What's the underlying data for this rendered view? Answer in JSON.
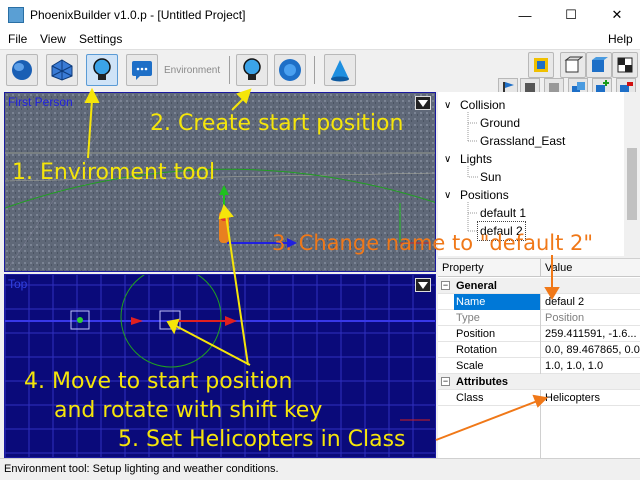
{
  "window": {
    "title": "PhoenixBuilder v1.0.p  - [Untitled Project]",
    "minimize": "—",
    "maximize": "☐",
    "close": "✕"
  },
  "menu": {
    "file": "File",
    "view": "View",
    "settings": "Settings",
    "help": "Help"
  },
  "toolbar": {
    "environment_label": "Environment"
  },
  "viewports": {
    "top_label": "First Person",
    "bottom_label": "Top"
  },
  "tree": {
    "items": [
      {
        "label": "Collision",
        "expander": "∨"
      },
      {
        "label": "Ground"
      },
      {
        "label": "Grassland_East"
      },
      {
        "label": "Lights",
        "expander": "∨"
      },
      {
        "label": "Sun"
      },
      {
        "label": "Positions",
        "expander": "∨"
      },
      {
        "label": "default 1"
      },
      {
        "label": "defaul 2"
      }
    ]
  },
  "properties": {
    "header_property": "Property",
    "header_value": "Value",
    "categories": [
      {
        "name": "General",
        "toggle": "−",
        "rows": [
          {
            "name": "Name",
            "value": "defaul 2"
          },
          {
            "name": "Type",
            "value": "Position"
          },
          {
            "name": "Position",
            "value": "259.411591, -1.6..."
          },
          {
            "name": "Rotation",
            "value": "0.0, 89.467865, 0.0"
          },
          {
            "name": "Scale",
            "value": "1.0, 1.0, 1.0"
          }
        ]
      },
      {
        "name": "Attributes",
        "toggle": "−",
        "rows": [
          {
            "name": "Class",
            "value": "Helicopters"
          }
        ]
      }
    ]
  },
  "status": {
    "text": "Environment tool: Setup lighting and weather conditions."
  },
  "annotations": {
    "step1": "1. Enviroment tool",
    "step2": "2. Create start position",
    "step3": "3. Change name to \"default 2\"",
    "step4a": "4. Move to start position",
    "step4b": "and rotate with shift key",
    "step5": "5. Set Helicopters in Class"
  },
  "colors": {
    "annotation_yellow": "#f5e50a",
    "annotation_orange": "#f07818",
    "selection_blue": "#0078d7",
    "viewport_blue": "#0a0a7a"
  },
  "icons": {
    "window_app": "app-icon",
    "toolbar": [
      "globe-icon",
      "mesh-icon",
      "bulb-icon",
      "chat-icon",
      "bulb-create-icon",
      "gear-icon",
      "cone-icon"
    ],
    "right_toolbar": [
      "lighting-icon",
      "cube-icon",
      "cube-blue-icon",
      "cube-checker-icon",
      "flag-icon",
      "cube-dark-icon",
      "cube-gray-icon",
      "cube-stack-icon",
      "add-icon",
      "delete-icon"
    ]
  }
}
